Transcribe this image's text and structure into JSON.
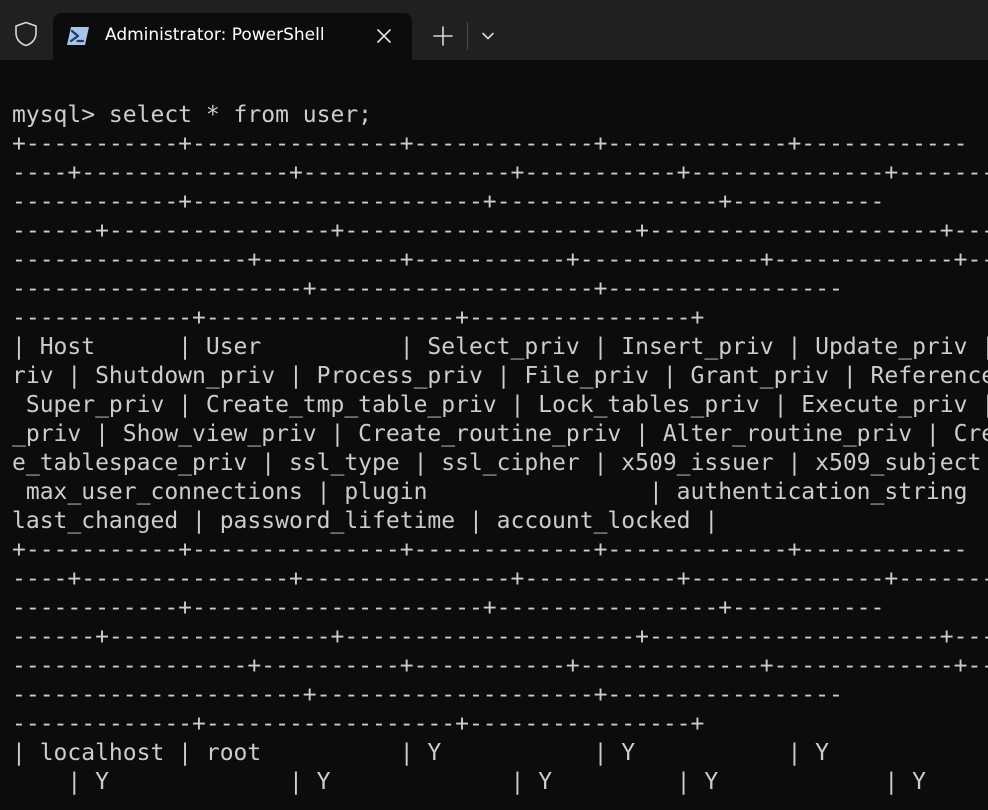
{
  "tab": {
    "title": "Administrator: PowerShell"
  },
  "icons": {
    "shield": "shield-icon",
    "powershell": "powershell-icon",
    "close": "close-icon",
    "add": "plus-icon",
    "dropdown": "chevron-down-icon"
  },
  "colors": {
    "titlebar": "#202020",
    "terminal_bg": "#0c0c0c",
    "terminal_text": "#cccccc",
    "powershell_icon": "#a9c4e8"
  },
  "terminal": {
    "lines": [
      "",
      "mysql> select * from user;",
      "+-----------+---------------+-------------+-------------+------------",
      "----+---------------+---------------+-----------+--------------+-----------",
      "------------+---------------------+----------------+-----------",
      "------+----------------+---------------------+---------------------+-----",
      "-----------------+----------+-----------+-------------+-------------+------",
      "---------------------+--------------------+-----------------",
      "-------------+------------------+----------------+",
      "| Host      | User          | Select_priv | Insert_priv | Update_priv |",
      "riv | Shutdown_priv | Process_priv | File_priv | Grant_priv | References",
      " Super_priv | Create_tmp_table_priv | Lock_tables_priv | Execute_priv |",
      "_priv | Show_view_priv | Create_routine_priv | Alter_routine_priv | Cre",
      "e_tablespace_priv | ssl_type | ssl_cipher | x509_issuer | x509_subject",
      " max_user_connections | plugin                | authentication_string",
      "last_changed | password_lifetime | account_locked |",
      "+-----------+---------------+-------------+-------------+------------",
      "----+---------------+---------------+-----------+--------------+-----------",
      "------------+---------------------+----------------+-----------",
      "------+----------------+---------------------+---------------------+-----",
      "-----------------+----------+-----------+-------------+-------------+------",
      "---------------------+--------------------+-----------------",
      "-------------+------------------+----------------+",
      "| localhost | root          | Y           | Y           | Y",
      "    | Y             | Y             | Y         | Y            | Y"
    ]
  }
}
